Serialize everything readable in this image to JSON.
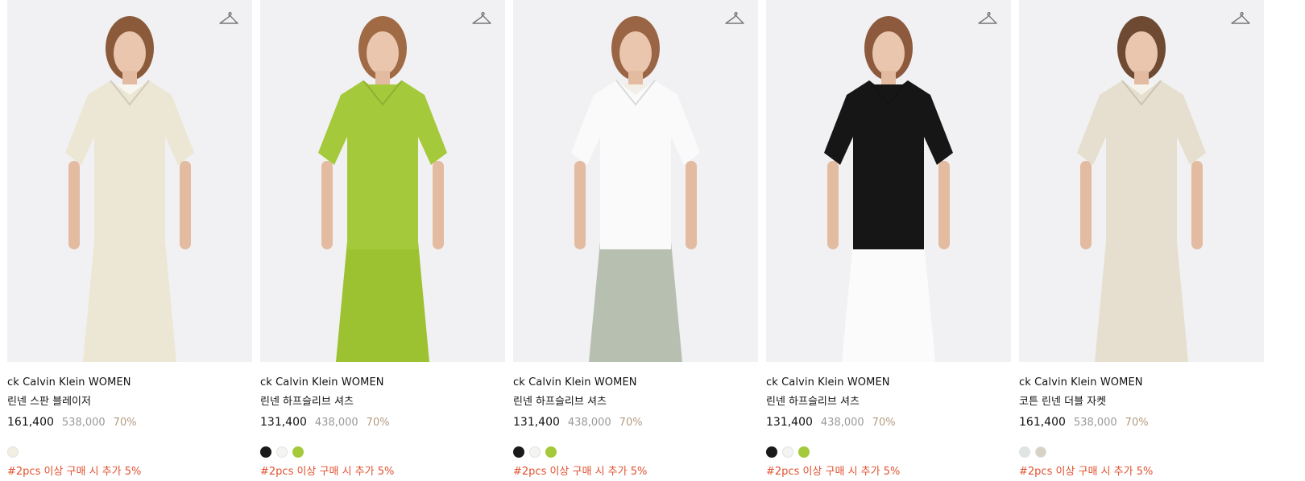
{
  "products": [
    {
      "brand": "ck Calvin Klein WOMEN",
      "name": "린넨 스판 블레이저",
      "price": "161,400",
      "original_price": "538,000",
      "discount": "70%",
      "swatches": [
        "#f2eee2"
      ],
      "promo": "#2pcs 이상 구매 시 추가 5%",
      "icon": "hanger-icon",
      "outfit": {
        "top": "#ece6d4",
        "bottom": "#ece6d4",
        "inner": "#f8f6f0",
        "hair": "#8a5a3a"
      }
    },
    {
      "brand": "ck Calvin Klein WOMEN",
      "name": "린넨 하프슬리브 셔츠",
      "price": "131,400",
      "original_price": "438,000",
      "discount": "70%",
      "swatches": [
        "#1a1a1a",
        "#f4f4f2",
        "#a4c93a"
      ],
      "promo": "#2pcs 이상 구매 시 추가 5%",
      "icon": "hanger-icon",
      "outfit": {
        "top": "#a4c93a",
        "bottom": "#9cc232",
        "inner": "#a4c93a",
        "hair": "#a06a45"
      }
    },
    {
      "brand": "ck Calvin Klein WOMEN",
      "name": "린넨 하프슬리브 셔츠",
      "price": "131,400",
      "original_price": "438,000",
      "discount": "70%",
      "swatches": [
        "#1a1a1a",
        "#f4f4f2",
        "#a4c93a"
      ],
      "promo": "#2pcs 이상 구매 시 추가 5%",
      "icon": "hanger-icon",
      "outfit": {
        "top": "#fafafa",
        "bottom": "#b7c0b0",
        "inner": "#f4efe6",
        "hair": "#9a6545"
      }
    },
    {
      "brand": "ck Calvin Klein WOMEN",
      "name": "린넨 하프슬리브 셔츠",
      "price": "131,400",
      "original_price": "438,000",
      "discount": "70%",
      "swatches": [
        "#1a1a1a",
        "#f4f4f2",
        "#a4c93a"
      ],
      "promo": "#2pcs 이상 구매 시 추가 5%",
      "icon": "hanger-icon",
      "outfit": {
        "top": "#161616",
        "bottom": "#fbfbfb",
        "inner": "#161616",
        "hair": "#8d5a3e"
      }
    },
    {
      "brand": "ck Calvin Klein WOMEN",
      "name": "코튼 린넨 더블 자켓",
      "price": "161,400",
      "original_price": "538,000",
      "discount": "70%",
      "swatches": [
        "#dfe6e2",
        "#d8d2c4"
      ],
      "promo": "#2pcs 이상 구매 시 추가 5%",
      "icon": "hanger-icon",
      "outfit": {
        "top": "#e6dfcf",
        "bottom": "#e6dfcf",
        "inner": "#f6f3ec",
        "hair": "#6e4a32"
      }
    }
  ]
}
